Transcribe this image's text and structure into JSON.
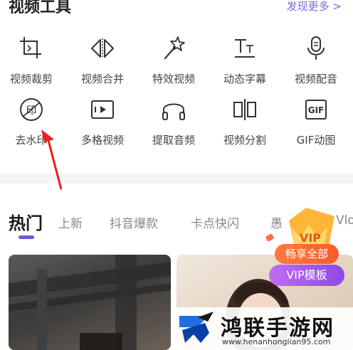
{
  "header": {
    "title": "视频工具",
    "more": "发现更多 >"
  },
  "tools": [
    {
      "label": "视频裁剪",
      "icon": "crop-icon"
    },
    {
      "label": "视频合并",
      "icon": "merge-icon"
    },
    {
      "label": "特效视频",
      "icon": "magic-wand-icon"
    },
    {
      "label": "动态字幕",
      "icon": "text-icon"
    },
    {
      "label": "视频配音",
      "icon": "microphone-icon"
    },
    {
      "label": "去水印",
      "icon": "watermark-icon"
    },
    {
      "label": "多格视频",
      "icon": "multi-grid-icon"
    },
    {
      "label": "提取音频",
      "icon": "headphones-icon"
    },
    {
      "label": "视频分割",
      "icon": "split-icon"
    },
    {
      "label": "GIF动图",
      "icon": "gif-icon"
    }
  ],
  "tabs": [
    {
      "label": "热门",
      "active": true
    },
    {
      "label": "上新"
    },
    {
      "label": "抖音爆款"
    },
    {
      "label": "卡点快闪"
    },
    {
      "label": "愚"
    },
    {
      "label": "Vlo"
    }
  ],
  "vip": {
    "badge": "VIP",
    "line1": "畅享全部",
    "line2": "VIP模板"
  },
  "watermark": {
    "title": "鸿联手游网",
    "url": "www.henanhonglian95.com"
  },
  "colors": {
    "accent": "#6b5bd6",
    "vip_orange": "#ff5a2c",
    "vip_purple": "#8b4be8"
  }
}
